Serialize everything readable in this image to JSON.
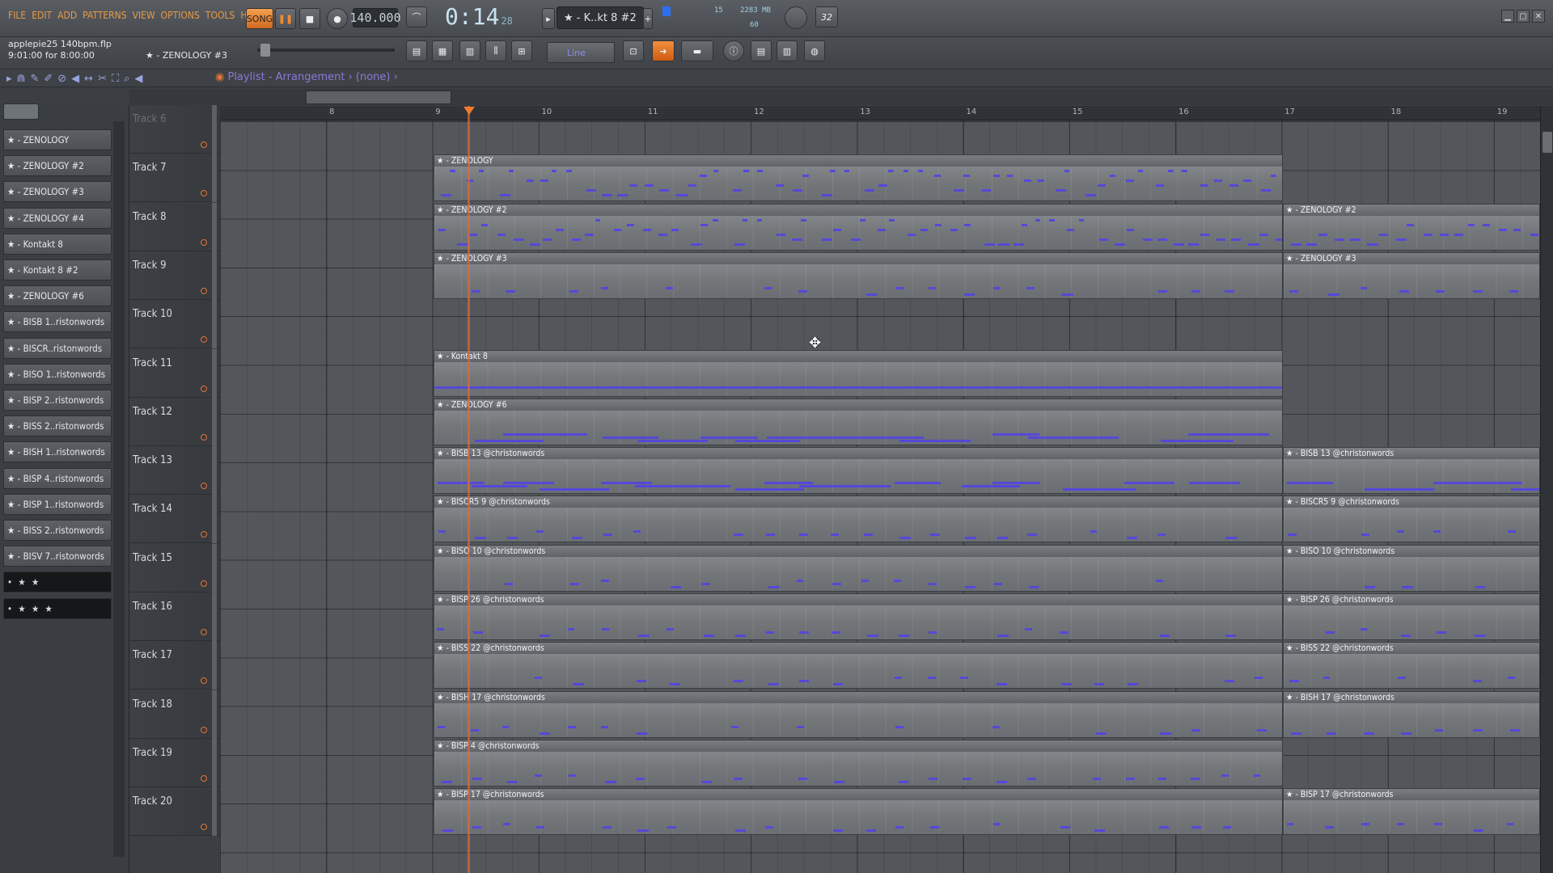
{
  "menu": [
    "FILE",
    "EDIT",
    "ADD",
    "PATTERNS",
    "VIEW",
    "OPTIONS",
    "TOOLS",
    "HELP"
  ],
  "transport": {
    "mode": "SONG",
    "tempo": "140.000",
    "time_main": "0:14",
    "time_sub": "28",
    "time_unit": "M:S:CS",
    "pattern": "★ - K..kt 8 #2",
    "cpu": "15",
    "mem": "2283 MB",
    "poly": "60",
    "bits": "32"
  },
  "hint": {
    "file": "applepie25 140bpm.flp",
    "time": "9:01:00 for 8:00:00",
    "pattern": "★ - ZENOLOGY #3"
  },
  "breadcrumb": "Playlist - Arrangement › (none) ›",
  "snap": "Line",
  "timeline": [
    "8",
    "9",
    "10",
    "11",
    "12",
    "13",
    "14",
    "15",
    "16",
    "17",
    "18",
    "19"
  ],
  "channels": [
    "★ - ZENOLOGY",
    "★ - ZENOLOGY #2",
    "★ - ZENOLOGY #3",
    "★ - ZENOLOGY #4",
    "★ - Kontakt 8",
    "★ - Kontakt 8 #2",
    "★ - ZENOLOGY #6",
    "★ - BISB 1..ristonwords",
    "★ - BISCR..ristonwords",
    "★ - BISO 1..ristonwords",
    "★ - BISP 2..ristonwords",
    "★ - BISS 2..ristonwords",
    "★ - BISH 1..ristonwords",
    "★ - BISP 4..ristonwords",
    "★ - BISP 1..ristonwords",
    "★ - BISS 2..ristonwords",
    "★ - BISV 7..ristonwords",
    "• ★ ★",
    "• ★ ★ ★"
  ],
  "tracks": [
    "Track 6",
    "Track 7",
    "Track 8",
    "Track 9",
    "Track 10",
    "Track 11",
    "Track 12",
    "Track 13",
    "Track 14",
    "Track 15",
    "Track 16",
    "Track 17",
    "Track 18",
    "Track 19",
    "Track 20"
  ],
  "clips": [
    {
      "track": 1,
      "label": "★ - ZENOLOGY",
      "second": ""
    },
    {
      "track": 2,
      "label": "★ - ZENOLOGY #2",
      "second": "★ - ZENOLOGY #2"
    },
    {
      "track": 3,
      "label": "★ - ZENOLOGY #3",
      "second": "★ - ZENOLOGY #3"
    },
    {
      "track": 5,
      "label": "★ - Kontakt 8",
      "second": ""
    },
    {
      "track": 6,
      "label": "★ - ZENOLOGY #6",
      "second": ""
    },
    {
      "track": 7,
      "label": "★ - BISB 13 @christonwords",
      "second": "★ - BISB 13 @christonwords"
    },
    {
      "track": 8,
      "label": "★ - BISCR5 9 @christonwords",
      "second": "★ - BISCR5 9 @christonwords"
    },
    {
      "track": 9,
      "label": "★ - BISO 10 @christonwords",
      "second": "★ - BISO 10 @christonwords"
    },
    {
      "track": 10,
      "label": "★ - BISP 26 @christonwords",
      "second": "★ - BISP 26 @christonwords"
    },
    {
      "track": 11,
      "label": "★ - BISS 22 @christonwords",
      "second": "★ - BISS 22 @christonwords"
    },
    {
      "track": 12,
      "label": "★ - BISH 17 @christonwords",
      "second": "★ - BISH 17 @christonwords"
    },
    {
      "track": 13,
      "label": "★ - BISP 4 @christonwords",
      "second": ""
    },
    {
      "track": 14,
      "label": "★ - BISP 17 @christonwords",
      "second": "★ - BISP 17 @christonwords"
    }
  ],
  "colors": {
    "note": "#5548d8",
    "accent": "#e79a45",
    "playhead": "#f07a2e"
  }
}
